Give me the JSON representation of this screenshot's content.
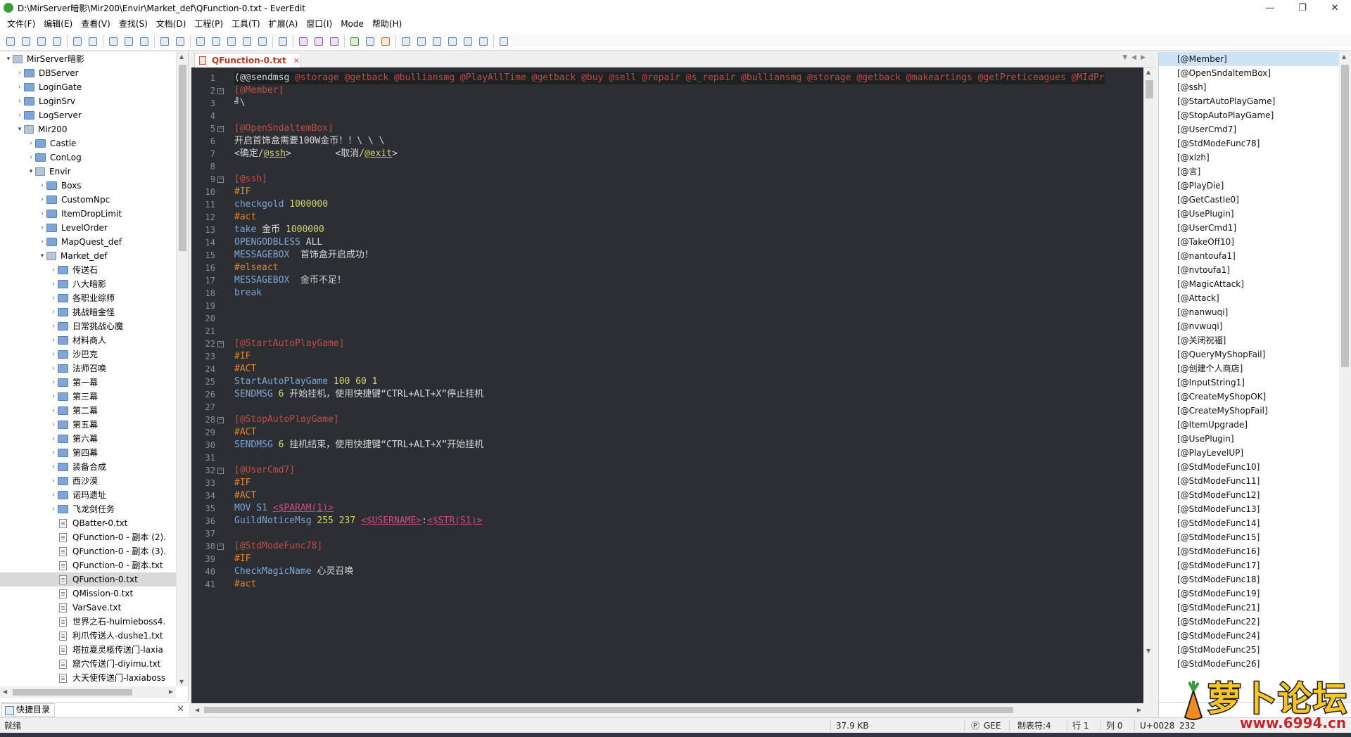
{
  "window": {
    "title": "D:\\MirServer暗影\\Mir200\\Envir\\Market_def\\QFunction-0.txt - EverEdit",
    "controls": [
      "—",
      "❐",
      "✕"
    ]
  },
  "menu": [
    "文件(F)",
    "编辑(E)",
    "查看(V)",
    "查找(S)",
    "文档(D)",
    "工程(P)",
    "工具(T)",
    "扩展(A)",
    "窗口(I)",
    "Mode",
    "帮助(H)"
  ],
  "tree": {
    "items": [
      {
        "label": "MirServer暗影",
        "indent": 0,
        "arrow": "▾",
        "type": "drive"
      },
      {
        "label": "DBServer",
        "indent": 1,
        "arrow": "›",
        "type": "folder"
      },
      {
        "label": "LoginGate",
        "indent": 1,
        "arrow": "›",
        "type": "folder"
      },
      {
        "label": "LoginSrv",
        "indent": 1,
        "arrow": "›",
        "type": "folder"
      },
      {
        "label": "LogServer",
        "indent": 1,
        "arrow": "›",
        "type": "folder"
      },
      {
        "label": "Mir200",
        "indent": 1,
        "arrow": "▾",
        "type": "drive"
      },
      {
        "label": "Castle",
        "indent": 2,
        "arrow": "›",
        "type": "folder"
      },
      {
        "label": "ConLog",
        "indent": 2,
        "arrow": "›",
        "type": "folder"
      },
      {
        "label": "Envir",
        "indent": 2,
        "arrow": "▾",
        "type": "drive"
      },
      {
        "label": "Boxs",
        "indent": 3,
        "arrow": "›",
        "type": "folder"
      },
      {
        "label": "CustomNpc",
        "indent": 3,
        "arrow": "›",
        "type": "folder"
      },
      {
        "label": "ItemDropLimit",
        "indent": 3,
        "arrow": "›",
        "type": "folder"
      },
      {
        "label": "LevelOrder",
        "indent": 3,
        "arrow": "›",
        "type": "folder"
      },
      {
        "label": "MapQuest_def",
        "indent": 3,
        "arrow": "›",
        "type": "folder"
      },
      {
        "label": "Market_def",
        "indent": 3,
        "arrow": "▾",
        "type": "drive"
      },
      {
        "label": "传送石",
        "indent": 4,
        "arrow": "›",
        "type": "folder"
      },
      {
        "label": "八大暗影",
        "indent": 4,
        "arrow": "›",
        "type": "folder"
      },
      {
        "label": "各职业综师",
        "indent": 4,
        "arrow": "›",
        "type": "folder"
      },
      {
        "label": "挑战暗金怪",
        "indent": 4,
        "arrow": "›",
        "type": "folder"
      },
      {
        "label": "日常挑战心魔",
        "indent": 4,
        "arrow": "›",
        "type": "folder"
      },
      {
        "label": "材料商人",
        "indent": 4,
        "arrow": "›",
        "type": "folder"
      },
      {
        "label": "沙巴克",
        "indent": 4,
        "arrow": "›",
        "type": "folder"
      },
      {
        "label": "法师召唤",
        "indent": 4,
        "arrow": "›",
        "type": "folder"
      },
      {
        "label": "第一幕",
        "indent": 4,
        "arrow": "›",
        "type": "folder"
      },
      {
        "label": "第三幕",
        "indent": 4,
        "arrow": "›",
        "type": "folder"
      },
      {
        "label": "第二幕",
        "indent": 4,
        "arrow": "›",
        "type": "folder"
      },
      {
        "label": "第五幕",
        "indent": 4,
        "arrow": "›",
        "type": "folder"
      },
      {
        "label": "第六幕",
        "indent": 4,
        "arrow": "›",
        "type": "folder"
      },
      {
        "label": "第四幕",
        "indent": 4,
        "arrow": "›",
        "type": "folder"
      },
      {
        "label": "装备合成",
        "indent": 4,
        "arrow": "›",
        "type": "folder"
      },
      {
        "label": "西沙漠",
        "indent": 4,
        "arrow": "›",
        "type": "folder"
      },
      {
        "label": "诺玛遗址",
        "indent": 4,
        "arrow": "›",
        "type": "folder"
      },
      {
        "label": "飞龙剑任务",
        "indent": 4,
        "arrow": "›",
        "type": "folder"
      },
      {
        "label": "QBatter-0.txt",
        "indent": 4,
        "arrow": "",
        "type": "file"
      },
      {
        "label": "QFunction-0 - 副本 (2).",
        "indent": 4,
        "arrow": "",
        "type": "file"
      },
      {
        "label": "QFunction-0 - 副本 (3).",
        "indent": 4,
        "arrow": "",
        "type": "file"
      },
      {
        "label": "QFunction-0 - 副本.txt",
        "indent": 4,
        "arrow": "",
        "type": "file"
      },
      {
        "label": "QFunction-0.txt",
        "indent": 4,
        "arrow": "",
        "type": "file",
        "selected": true
      },
      {
        "label": "QMission-0.txt",
        "indent": 4,
        "arrow": "",
        "type": "file"
      },
      {
        "label": "VarSave.txt",
        "indent": 4,
        "arrow": "",
        "type": "file"
      },
      {
        "label": "世界之石-huimieboss4.",
        "indent": 4,
        "arrow": "",
        "type": "file"
      },
      {
        "label": "利爪传送人-dushe1.txt",
        "indent": 4,
        "arrow": "",
        "type": "file"
      },
      {
        "label": "塔拉夏灵柩传送门-laxia",
        "indent": 4,
        "arrow": "",
        "type": "file"
      },
      {
        "label": "窟穴传送门-diyimu.txt",
        "indent": 4,
        "arrow": "",
        "type": "file"
      },
      {
        "label": "大天使传送门-laxiaboss",
        "indent": 4,
        "arrow": "",
        "type": "file"
      }
    ]
  },
  "left_tab": "快捷目录",
  "editor": {
    "tab_label": "QFunction-0.txt",
    "tab_close": "✕",
    "lines": [
      {
        "n": "1",
        "fold": "",
        "segs": [
          [
            "t",
            "(@@sendmsg "
          ],
          [
            "l",
            "@storage @getback @bulliansmg @PlayAllTime @getback @buy @sell @repair @s_repair @bulliansmg @storage @getback @makeartings @getPreticeagues @MIdPr"
          ]
        ]
      },
      {
        "n": "2",
        "fold": "⊟",
        "segs": [
          [
            "l",
            "[@Member]"
          ]
        ]
      },
      {
        "n": "3",
        "fold": "",
        "segs": [
          [
            "t",
            "╝\\"
          ]
        ]
      },
      {
        "n": "4",
        "fold": "",
        "segs": []
      },
      {
        "n": "5",
        "fold": "⊟",
        "segs": [
          [
            "l",
            "[@OpenSndaltemBox]"
          ]
        ]
      },
      {
        "n": "6",
        "fold": "",
        "segs": [
          [
            "t",
            "开启首饰盒需要100W金币！！\\ \\ \\"
          ]
        ]
      },
      {
        "n": "7",
        "fold": "",
        "segs": [
          [
            "t",
            "<确定/"
          ],
          [
            "k",
            "@ssh"
          ],
          [
            "t",
            ">        <取消/"
          ],
          [
            "k",
            "@exit"
          ],
          [
            "t",
            ">"
          ]
        ]
      },
      {
        "n": "8",
        "fold": "",
        "segs": []
      },
      {
        "n": "9",
        "fold": "⊟",
        "segs": [
          [
            "l",
            "[@ssh]"
          ]
        ]
      },
      {
        "n": "10",
        "fold": "",
        "segs": [
          [
            "o",
            "#IF"
          ]
        ]
      },
      {
        "n": "11",
        "fold": "",
        "segs": [
          [
            "c",
            "checkgold "
          ],
          [
            "n",
            "1000000"
          ]
        ]
      },
      {
        "n": "12",
        "fold": "",
        "segs": [
          [
            "o",
            "#act"
          ]
        ]
      },
      {
        "n": "13",
        "fold": "",
        "segs": [
          [
            "c",
            "take "
          ],
          [
            "t",
            "金币 "
          ],
          [
            "n",
            "1000000"
          ]
        ]
      },
      {
        "n": "14",
        "fold": "",
        "segs": [
          [
            "c",
            "OPENGODBLESS "
          ],
          [
            "t",
            "ALL"
          ]
        ]
      },
      {
        "n": "15",
        "fold": "",
        "segs": [
          [
            "c",
            "MESSAGEBOX "
          ],
          [
            "t",
            " 首饰盒开启成功！"
          ]
        ]
      },
      {
        "n": "16",
        "fold": "",
        "segs": [
          [
            "o",
            "#elseact"
          ]
        ]
      },
      {
        "n": "17",
        "fold": "",
        "segs": [
          [
            "c",
            "MESSAGEBOX "
          ],
          [
            "t",
            " 金币不足！"
          ]
        ]
      },
      {
        "n": "18",
        "fold": "",
        "segs": [
          [
            "c",
            "break"
          ]
        ]
      },
      {
        "n": "19",
        "fold": "",
        "segs": []
      },
      {
        "n": "20",
        "fold": "",
        "segs": []
      },
      {
        "n": "21",
        "fold": "",
        "segs": []
      },
      {
        "n": "22",
        "fold": "⊟",
        "segs": [
          [
            "l",
            "[@StartAutoPlayGame]"
          ]
        ]
      },
      {
        "n": "23",
        "fold": "",
        "segs": [
          [
            "o",
            "#IF"
          ]
        ]
      },
      {
        "n": "24",
        "fold": "",
        "segs": [
          [
            "o",
            "#ACT"
          ]
        ]
      },
      {
        "n": "25",
        "fold": "",
        "segs": [
          [
            "c",
            "StartAutoPlayGame "
          ],
          [
            "n",
            "100 60 1"
          ]
        ]
      },
      {
        "n": "26",
        "fold": "",
        "segs": [
          [
            "c",
            "SENDMSG "
          ],
          [
            "n",
            "6"
          ],
          [
            "t",
            " 开始挂机，使用快捷键“CTRL+ALT+X”停止挂机"
          ]
        ]
      },
      {
        "n": "27",
        "fold": "",
        "segs": []
      },
      {
        "n": "28",
        "fold": "⊟",
        "segs": [
          [
            "l",
            "[@StopAutoPlayGame]"
          ]
        ]
      },
      {
        "n": "29",
        "fold": "",
        "segs": [
          [
            "o",
            "#ACT"
          ]
        ]
      },
      {
        "n": "30",
        "fold": "",
        "segs": [
          [
            "c",
            "SENDMSG "
          ],
          [
            "n",
            "6"
          ],
          [
            "t",
            " 挂机结束，使用快捷键“CTRL+ALT+X”开始挂机"
          ]
        ]
      },
      {
        "n": "31",
        "fold": "",
        "segs": []
      },
      {
        "n": "32",
        "fold": "⊟",
        "segs": [
          [
            "l",
            "[@UserCmd7]"
          ]
        ]
      },
      {
        "n": "33",
        "fold": "",
        "segs": [
          [
            "o",
            "#IF"
          ]
        ]
      },
      {
        "n": "34",
        "fold": "",
        "segs": [
          [
            "o",
            "#ACT"
          ]
        ]
      },
      {
        "n": "35",
        "fold": "",
        "segs": [
          [
            "c",
            "MOV S1 "
          ],
          [
            "v",
            "<$PARAM(1)>"
          ]
        ]
      },
      {
        "n": "36",
        "fold": "",
        "segs": [
          [
            "c",
            "GuildNoticeMsg "
          ],
          [
            "n",
            "255 237 "
          ],
          [
            "v",
            "<$USERNAME>"
          ],
          [
            "t",
            ":"
          ],
          [
            "v",
            "<$STR(S1)>"
          ]
        ]
      },
      {
        "n": "37",
        "fold": "",
        "segs": []
      },
      {
        "n": "38",
        "fold": "⊟",
        "segs": [
          [
            "l",
            "[@StdModeFunc78]"
          ]
        ]
      },
      {
        "n": "39",
        "fold": "",
        "segs": [
          [
            "o",
            "#IF"
          ]
        ]
      },
      {
        "n": "40",
        "fold": "",
        "segs": [
          [
            "c",
            "CheckMagicName "
          ],
          [
            "t",
            "心灵召唤"
          ]
        ]
      },
      {
        "n": "41",
        "fold": "",
        "segs": [
          [
            "o",
            "#act"
          ]
        ]
      }
    ]
  },
  "labels": {
    "items": [
      "[@Member]",
      "[@OpenSndaltemBox]",
      "[@ssh]",
      "[@StartAutoPlayGame]",
      "[@StopAutoPlayGame]",
      "[@UserCmd7]",
      "[@StdModeFunc78]",
      "[@xlzh]",
      "[@言]",
      "[@PlayDie]",
      "[@GetCastle0]",
      "[@UsePlugin]",
      "[@UserCmd1]",
      "[@TakeOff10]",
      "[@nantoufa1]",
      "[@nvtoufa1]",
      "[@MagicAttack]",
      "[@Attack]",
      "[@nanwuqi]",
      "[@nvwuqi]",
      "[@关闭祝福]",
      "[@QueryMyShopFail]",
      "[@创建个人商店]",
      "[@InputString1]",
      "[@CreateMyShopOK]",
      "[@CreateMyShopFail]",
      "[@ItemUpgrade]",
      "[@UsePlugin]",
      "[@PlayLevelUP]",
      "[@StdModeFunc10]",
      "[@StdModeFunc11]",
      "[@StdModeFunc12]",
      "[@StdModeFunc13]",
      "[@StdModeFunc14]",
      "[@StdModeFunc15]",
      "[@StdModeFunc16]",
      "[@StdModeFunc17]",
      "[@StdModeFunc18]",
      "[@StdModeFunc19]",
      "[@StdModeFunc21]",
      "[@StdModeFunc22]",
      "[@StdModeFunc24]",
      "[@StdModeFunc25]",
      "[@StdModeFunc26]"
    ]
  },
  "status": {
    "ready": "就绪",
    "size": "37.9 KB",
    "encoding": "GEE",
    "tab": "制表符:4",
    "line": "行 1",
    "col": "列 0",
    "unicode": "U+0028",
    "extra": "232"
  },
  "watermark": {
    "text": "萝卜论坛",
    "url": "www.6994.cn"
  },
  "colors": {
    "editor_bg": "#2b2f33",
    "label": "#c54a44",
    "keyword": "#e3812b",
    "command": "#7ea4d6",
    "number": "#d8d46a"
  }
}
